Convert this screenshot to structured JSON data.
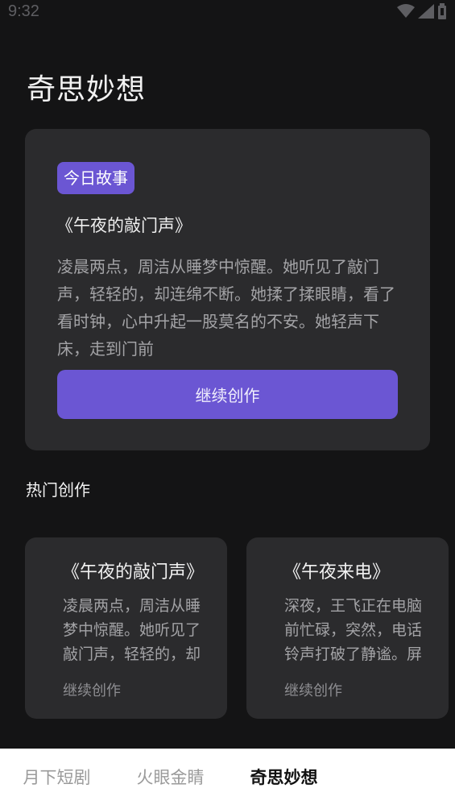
{
  "status_bar": {
    "time": "9:32"
  },
  "page": {
    "title": "奇思妙想"
  },
  "today_story": {
    "tag": "今日故事",
    "title": "《午夜的敲门声》",
    "excerpt": "凌晨两点，周洁从睡梦中惊醒。她听见了敲门声，轻轻的，却连绵不断。她揉了揉眼睛，看了看时钟，心中升起一股莫名的不安。她轻声下床，走到门前",
    "button_label": "继续创作"
  },
  "hot_section": {
    "title": "热门创作",
    "cards": [
      {
        "title": "《午夜的敲门声》",
        "excerpt": "凌晨两点，周洁从睡梦中惊醒。她听见了敲门声，轻轻的，却连绵不断。",
        "link": "继续创作"
      },
      {
        "title": "《午夜来电》",
        "excerpt": "深夜，王飞正在电脑前忙碌，突然，电话铃声打破了静谧。屏幕上",
        "link": "继续创作"
      }
    ]
  },
  "bottom_nav": {
    "tabs": [
      {
        "label": "月下短剧"
      },
      {
        "label": "火眼金睛"
      },
      {
        "label": "奇思妙想"
      },
      {
        "label": ""
      }
    ],
    "active_index": 2
  },
  "colors": {
    "background": "#141415",
    "card": "#2b2b2d",
    "accent": "#6b56d3"
  }
}
